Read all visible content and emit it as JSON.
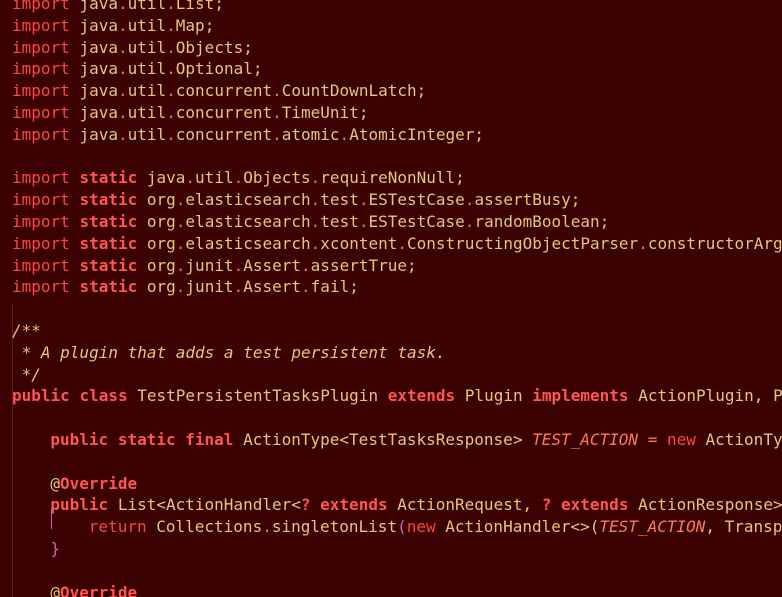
{
  "imports_java": [
    {
      "pkg": "java.util",
      "name": "List"
    },
    {
      "pkg": "java.util",
      "name": "Map"
    },
    {
      "pkg": "java.util",
      "name": "Objects"
    },
    {
      "pkg": "java.util",
      "name": "Optional"
    },
    {
      "pkg": "java.util.concurrent",
      "name": "CountDownLatch"
    },
    {
      "pkg": "java.util.concurrent",
      "name": "TimeUnit"
    },
    {
      "pkg": "java.util.concurrent.atomic",
      "name": "AtomicInteger"
    }
  ],
  "imports_static": [
    "java.util.Objects.requireNonNull",
    "org.elasticsearch.test.ESTestCase.assertBusy",
    "org.elasticsearch.test.ESTestCase.randomBoolean",
    "org.elasticsearch.xcontent.ConstructingObjectParser.constructorArg",
    "org.junit.Assert.assertTrue",
    "org.junit.Assert.fail"
  ],
  "keywords": {
    "import": "import",
    "static": "static",
    "public": "public",
    "class": "class",
    "extends": "extends",
    "implements": "implements",
    "final": "final",
    "new": "new",
    "return": "return"
  },
  "javadoc": {
    "open": "/**",
    "body": " * A plugin that adds a test persistent task.",
    "close": " */"
  },
  "class_decl": {
    "name": "TestPersistentTasksPlugin",
    "superclass": "Plugin",
    "interfaces": "ActionPlugin, P"
  },
  "field_decl": {
    "type": "ActionType",
    "generic": "TestTasksResponse",
    "name": "TEST_ACTION",
    "assign": " = ",
    "rhs": "ActionTy"
  },
  "annotation": {
    "at": "@",
    "name": "Override"
  },
  "method_decl": {
    "return_type": "List",
    "generic_outer": "ActionHandler",
    "wildcard": "?",
    "bound1": "ActionRequest",
    "bound2": "ActionResponse",
    "tail": ">"
  },
  "return_stmt": {
    "call": "Collections.singletonList",
    "ctor": "ActionHandler",
    "diamond": "<>",
    "arg1": "TEST_ACTION",
    "arg2": "Transp"
  },
  "closing_brace": "}"
}
